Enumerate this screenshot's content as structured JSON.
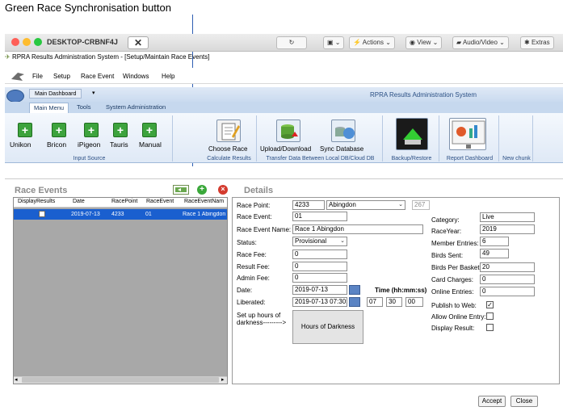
{
  "annotation": {
    "text": "Green Race Synchronisation button"
  },
  "window": {
    "host": "DESKTOP-CRBNF4J",
    "toolbar": {
      "actions": "Actions",
      "view": "View",
      "audio_video": "Audio/Video",
      "extras": "Extras"
    },
    "app_title": "RPRA Results Administration System - [Setup/Maintain Race Events]"
  },
  "menu": [
    "File",
    "Setup",
    "Race Event",
    "Windows",
    "Help"
  ],
  "ribbon": {
    "dashboard": "Main Dashboard",
    "system_title": "RPRA Results Administration System",
    "tabs": [
      "Main Menu",
      "Tools",
      "System Administration"
    ],
    "input_source": {
      "label": "Input Source",
      "items": [
        "Unikon",
        "Bricon",
        "iPigeon",
        "Tauris",
        "Manual"
      ]
    },
    "calculate": {
      "label": "Calculate Results",
      "item": "Choose Race"
    },
    "transfer": {
      "label": "Transfer Data Between Local DB/Cloud DB",
      "items": [
        "Upload/Download",
        "Sync Database"
      ]
    },
    "backup": {
      "label": "Backup/Restore"
    },
    "report": {
      "label": "Report Dashboard"
    },
    "newchunk": {
      "label": "New chunk"
    }
  },
  "race_events": {
    "title": "Race Events",
    "columns": [
      "DisplayResults",
      "Date",
      "RacePoint",
      "RaceEvent",
      "RaceEventNam"
    ],
    "rows": [
      {
        "date": "2019-07-13",
        "racepoint": "4233",
        "raceevent": "01",
        "name": "Race 1 Abingdon"
      }
    ]
  },
  "details": {
    "title": "Details",
    "race_point_label": "Race Point:",
    "race_point_code": "4233",
    "race_point_name": "Abingdon",
    "race_point_extra": "267",
    "race_event_label": "Race Event:",
    "race_event": "01",
    "race_event_name_label": "Race Event Name:",
    "race_event_name": "Race 1 Abingdon",
    "status_label": "Status:",
    "status": "Provisional",
    "race_fee_label": "Race Fee:",
    "race_fee": "0",
    "result_fee_label": "Result Fee:",
    "result_fee": "0",
    "admin_fee_label": "Admin Fee:",
    "admin_fee": "0",
    "date_label": "Date:",
    "date": "2019-07-13",
    "time_label": "Time (hh:mm:ss)",
    "liberated_label": "Liberated:",
    "liberated": "2019-07-13 07:30:0",
    "lib_h": "07",
    "lib_m": "30",
    "lib_s": "00",
    "darkness_label": "Set up hours of darkness--------->",
    "darkness_button": "Hours of Darkness",
    "category_label": "Category:",
    "category": "Live",
    "raceyear_label": "RaceYear:",
    "raceyear": "2019",
    "member_entries_label": "Member Entries:",
    "member_entries": "6",
    "birds_sent_label": "Birds Sent:",
    "birds_sent": "49",
    "birds_per_basket_label": "Birds Per Basket:",
    "birds_per_basket": "20",
    "card_charges_label": "Card Charges:",
    "card_charges": "0",
    "online_entries_label": "Online Entries:",
    "online_entries": "0",
    "publish_label": "Publish to Web:",
    "allow_online_label": "Allow Online Entry:",
    "display_result_label": "Display Result:"
  },
  "buttons": {
    "accept": "Accept",
    "close": "Close"
  }
}
